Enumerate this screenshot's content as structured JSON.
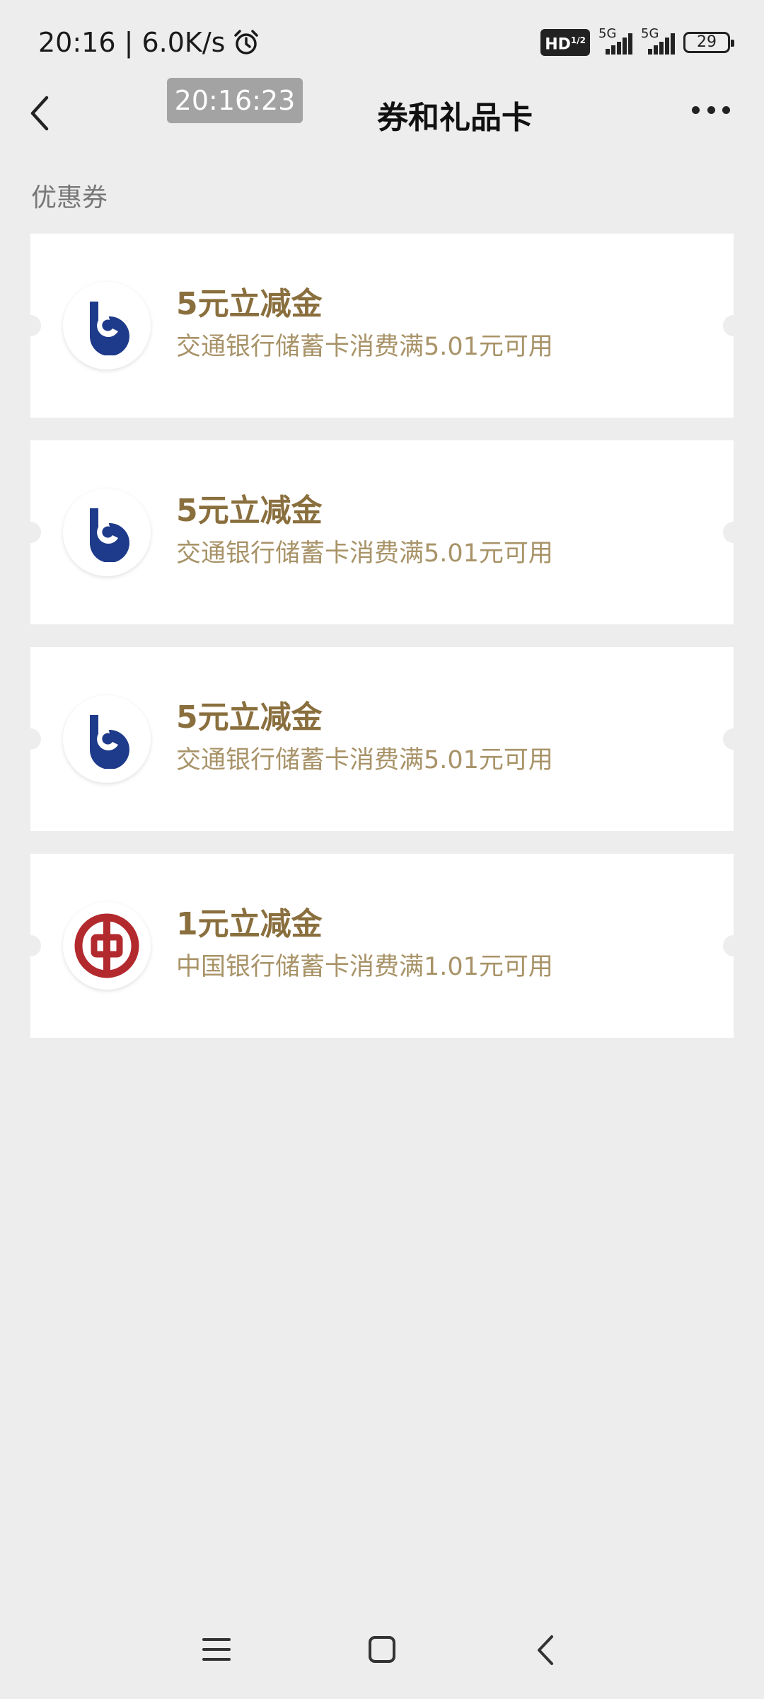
{
  "status_bar": {
    "time": "20:16",
    "speed": "6.0K/s",
    "hd_badge": "HD",
    "hd_sub": "1/2",
    "network1": "5G",
    "network2": "5G",
    "battery": "29"
  },
  "header": {
    "time_overlay": "20:16:23",
    "title": "券和礼品卡"
  },
  "section": {
    "label": "优惠券"
  },
  "coupons": [
    {
      "title": "5元立减金",
      "desc": "交通银行储蓄卡消费满5.01元可用",
      "bank_icon": "bank-of-communications-logo"
    },
    {
      "title": "5元立减金",
      "desc": "交通银行储蓄卡消费满5.01元可用",
      "bank_icon": "bank-of-communications-logo"
    },
    {
      "title": "5元立减金",
      "desc": "交通银行储蓄卡消费满5.01元可用",
      "bank_icon": "bank-of-communications-logo"
    },
    {
      "title": "1元立减金",
      "desc": "中国银行储蓄卡消费满1.01元可用",
      "bank_icon": "bank-of-china-logo"
    }
  ],
  "colors": {
    "title_gold": "#8a6f3e",
    "desc_gold": "#a89368",
    "bocom_blue": "#1e3a8a",
    "boc_red": "#b22a2e",
    "background": "#ededed"
  }
}
